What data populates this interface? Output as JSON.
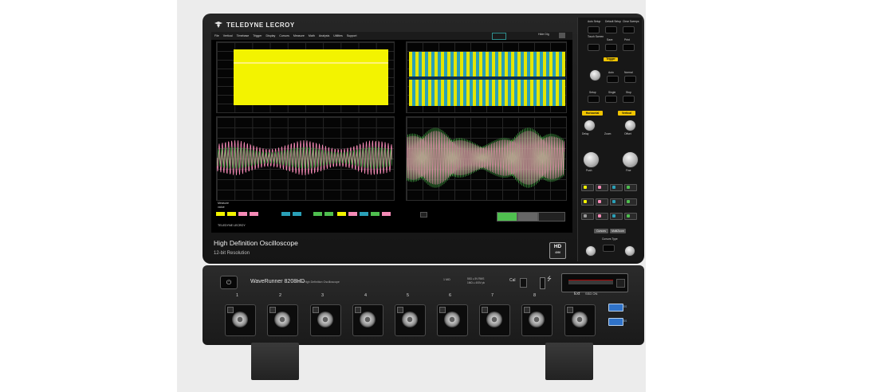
{
  "brand": {
    "logo_text": "TELEDYNE LECROY"
  },
  "screen": {
    "menu": [
      "File",
      "Vertical",
      "Timebase",
      "Trigger",
      "Display",
      "Cursors",
      "Measure",
      "Math",
      "Analysis",
      "Utilities",
      "Support"
    ],
    "hide_label": "Hide Dlg",
    "readout_title": "Measure",
    "readout_value_label": "value",
    "footer_brand": "TELEDYNE LECROY"
  },
  "right_panel": {
    "top_labels": [
      "Auto Setup",
      "Default Setup",
      "Clear Sweeps",
      "Touch Screen",
      "Save",
      "Print"
    ],
    "trigger_tag": "Trigger",
    "trigger_labels": [
      "Auto",
      "Normal",
      "Setup",
      "Single",
      "Stop"
    ],
    "horizontal_tag": "Horizontal",
    "vertical_tag": "Vertical",
    "zoom_tag": "Zoom",
    "cursors_label": "Cursors Type",
    "horizontal_knob_label": "Delay",
    "vertical_knob_label": "Offset",
    "push_label": "Push",
    "fine_label": "Fine",
    "cursors_tag": "Cursors",
    "multi_tag": "MultiZoom"
  },
  "caption": {
    "title": "High Definition Oscilloscope",
    "subtitle": "12-bit Resolution",
    "hd_badge": "HD",
    "hd_sub": "4096"
  },
  "front_panel": {
    "power_icon": "power-icon",
    "model": "WaveRunner 8208HD",
    "model_sub": "2 GHz High Definition Oscilloscope",
    "spec1": "1 MΩ",
    "spec2": "50Ω ≤ 5V RMS\n1MΩ ≤ 400V pk",
    "cal_label": "Cal",
    "usb_icon": "usb-icon",
    "bay_label": "SSD ON",
    "channels": [
      "1",
      "2",
      "3",
      "4",
      "5",
      "6",
      "7",
      "8"
    ],
    "ext_label": "Ext",
    "usb_labels": [
      "SS",
      "SS"
    ]
  },
  "colors": {
    "ch1": "#f3f300",
    "ch2": "#f58ab6",
    "ch3": "#2aa0b8",
    "ch4": "#4fbf4f",
    "bezel": "#1e1e1e",
    "trigger_tag": "#f0c400"
  }
}
